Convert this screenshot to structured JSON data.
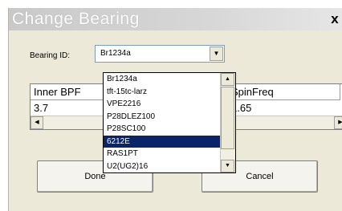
{
  "window": {
    "title": "Change Bearing",
    "close_label": "x"
  },
  "form": {
    "bearing_label": "Bearing ID:",
    "bearing_value": "Br1234a"
  },
  "grid": {
    "columns": [
      "Inner BPF",
      "SpinFreq"
    ],
    "row": [
      "3.7",
      "1.65"
    ]
  },
  "dropdown": {
    "items": [
      "Br1234a",
      "tft-15tc-larz",
      "VPE2216",
      "P28DLEZ100",
      "P28SC100",
      "6212E",
      "RAS1PT",
      "U2(UG2)16"
    ],
    "selected_index": 5
  },
  "buttons": {
    "done": "Done",
    "cancel": "Cancel"
  }
}
